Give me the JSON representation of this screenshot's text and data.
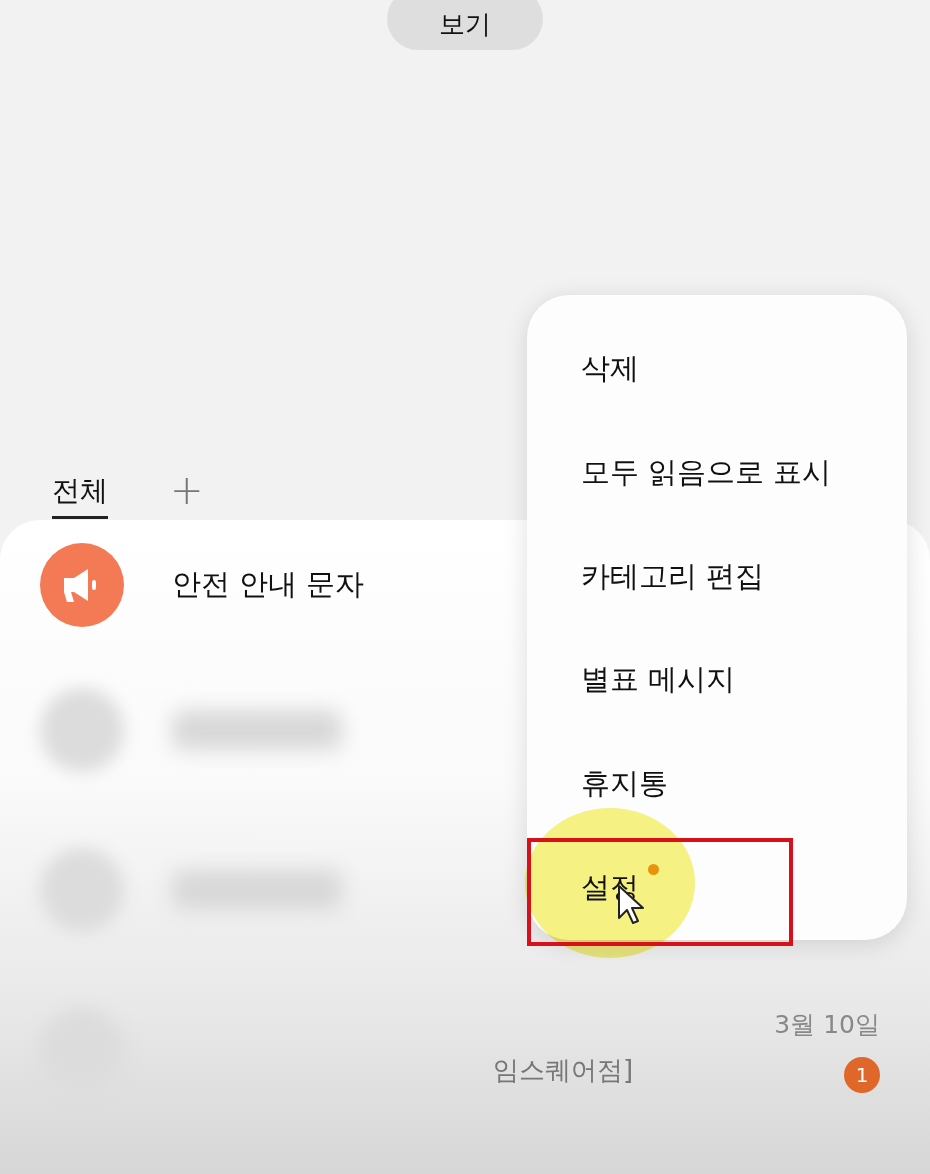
{
  "view_button": {
    "label": "보기"
  },
  "tabs": [
    {
      "label": "전체",
      "selected": true
    }
  ],
  "add_tab": {
    "label": "+"
  },
  "conversations": [
    {
      "kind": "alert",
      "name": "안전 안내 문자"
    },
    {
      "kind": "blurred"
    },
    {
      "kind": "blurred"
    },
    {
      "kind": "blurred",
      "preview": "임스퀘어점]",
      "date": "3월 10일",
      "unread": "1"
    }
  ],
  "menu": {
    "items": [
      {
        "label": "삭제",
        "highlighted": false,
        "badge": false
      },
      {
        "label": "모두 읽음으로 표시",
        "highlighted": false,
        "badge": false
      },
      {
        "label": "카테고리 편집",
        "highlighted": false,
        "badge": false
      },
      {
        "label": "별표 메시지",
        "highlighted": false,
        "badge": false
      },
      {
        "label": "휴지통",
        "highlighted": false,
        "badge": false
      },
      {
        "label": "설정",
        "highlighted": true,
        "badge": true
      }
    ]
  }
}
